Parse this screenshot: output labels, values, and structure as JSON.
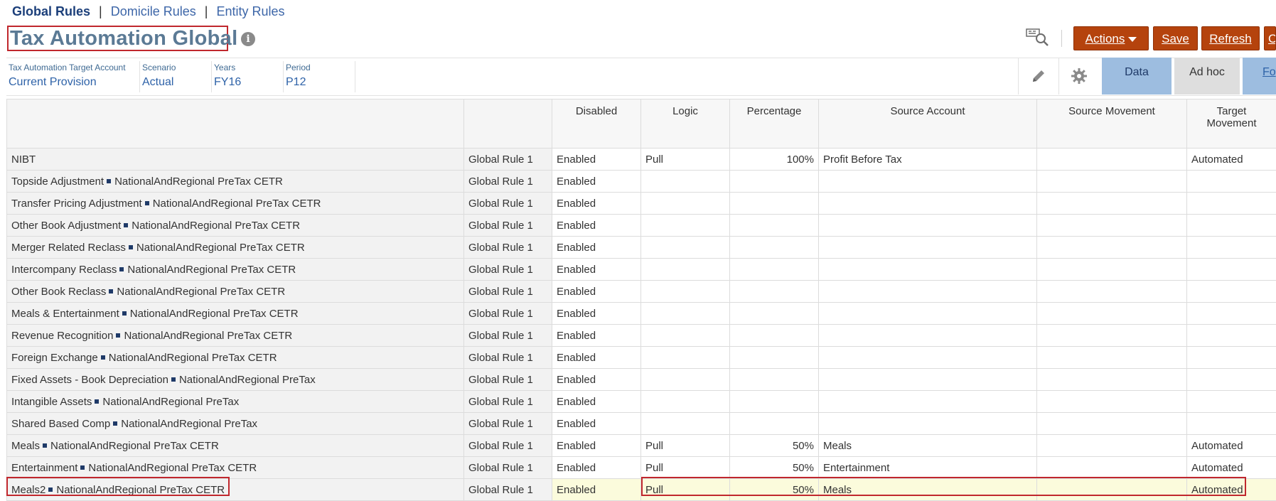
{
  "nav": {
    "tabs": [
      "Global Rules",
      "Domicile Rules",
      "Entity Rules"
    ],
    "separator": "|"
  },
  "header": {
    "title": "Tax Automation Global",
    "info_icon": "info-icon",
    "pov_icon": "member-selector-icon"
  },
  "toolbar": {
    "actions_label": "Actions",
    "save_label": "Save",
    "refresh_label": "Refresh",
    "more_label": "C"
  },
  "pov": [
    {
      "label": "Tax Automation Target Account",
      "value": "Current Provision"
    },
    {
      "label": "Scenario",
      "value": "Actual"
    },
    {
      "label": "Years",
      "value": "FY16"
    },
    {
      "label": "Period",
      "value": "P12"
    }
  ],
  "view_tabs": {
    "edit_icon": "pencil-icon",
    "settings_icon": "gear-icon",
    "data_label": "Data",
    "adhoc_label": "Ad hoc",
    "format_label": "Fo"
  },
  "grid": {
    "columns": [
      "Disabled",
      "Logic",
      "Percentage",
      "Source Account",
      "Source Movement",
      "Target Movement"
    ],
    "rows": [
      {
        "account": "NIBT",
        "tag": "",
        "rule": "Global Rule 1",
        "disabled": "Enabled",
        "logic": "Pull",
        "pct": "100%",
        "src_acct": "Profit Before Tax",
        "src_mvmt": "",
        "tgt_mvmt": "Automated"
      },
      {
        "account": "Topside Adjustment",
        "tag": "NationalAndRegional PreTax CETR",
        "rule": "Global Rule 1",
        "disabled": "Enabled",
        "logic": "",
        "pct": "",
        "src_acct": "",
        "src_mvmt": "",
        "tgt_mvmt": ""
      },
      {
        "account": "Transfer Pricing Adjustment",
        "tag": "NationalAndRegional PreTax CETR",
        "rule": "Global Rule 1",
        "disabled": "Enabled",
        "logic": "",
        "pct": "",
        "src_acct": "",
        "src_mvmt": "",
        "tgt_mvmt": ""
      },
      {
        "account": "Other Book Adjustment",
        "tag": "NationalAndRegional PreTax CETR",
        "rule": "Global Rule 1",
        "disabled": "Enabled",
        "logic": "",
        "pct": "",
        "src_acct": "",
        "src_mvmt": "",
        "tgt_mvmt": ""
      },
      {
        "account": "Merger Related Reclass",
        "tag": "NationalAndRegional PreTax CETR",
        "rule": "Global Rule 1",
        "disabled": "Enabled",
        "logic": "",
        "pct": "",
        "src_acct": "",
        "src_mvmt": "",
        "tgt_mvmt": ""
      },
      {
        "account": "Intercompany Reclass",
        "tag": "NationalAndRegional PreTax CETR",
        "rule": "Global Rule 1",
        "disabled": "Enabled",
        "logic": "",
        "pct": "",
        "src_acct": "",
        "src_mvmt": "",
        "tgt_mvmt": ""
      },
      {
        "account": "Other Book Reclass",
        "tag": "NationalAndRegional PreTax CETR",
        "rule": "Global Rule 1",
        "disabled": "Enabled",
        "logic": "",
        "pct": "",
        "src_acct": "",
        "src_mvmt": "",
        "tgt_mvmt": ""
      },
      {
        "account": "Meals & Entertainment",
        "tag": "NationalAndRegional PreTax CETR",
        "rule": "Global Rule 1",
        "disabled": "Enabled",
        "logic": "",
        "pct": "",
        "src_acct": "",
        "src_mvmt": "",
        "tgt_mvmt": ""
      },
      {
        "account": "Revenue Recognition",
        "tag": "NationalAndRegional PreTax CETR",
        "rule": "Global Rule 1",
        "disabled": "Enabled",
        "logic": "",
        "pct": "",
        "src_acct": "",
        "src_mvmt": "",
        "tgt_mvmt": ""
      },
      {
        "account": "Foreign Exchange",
        "tag": "NationalAndRegional PreTax CETR",
        "rule": "Global Rule 1",
        "disabled": "Enabled",
        "logic": "",
        "pct": "",
        "src_acct": "",
        "src_mvmt": "",
        "tgt_mvmt": ""
      },
      {
        "account": "Fixed Assets - Book Depreciation",
        "tag": "NationalAndRegional PreTax",
        "rule": "Global Rule 1",
        "disabled": "Enabled",
        "logic": "",
        "pct": "",
        "src_acct": "",
        "src_mvmt": "",
        "tgt_mvmt": ""
      },
      {
        "account": "Intangible Assets",
        "tag": "NationalAndRegional PreTax",
        "rule": "Global Rule 1",
        "disabled": "Enabled",
        "logic": "",
        "pct": "",
        "src_acct": "",
        "src_mvmt": "",
        "tgt_mvmt": ""
      },
      {
        "account": "Shared Based Comp",
        "tag": "NationalAndRegional PreTax",
        "rule": "Global Rule 1",
        "disabled": "Enabled",
        "logic": "",
        "pct": "",
        "src_acct": "",
        "src_mvmt": "",
        "tgt_mvmt": ""
      },
      {
        "account": "Meals",
        "tag": "NationalAndRegional PreTax CETR",
        "rule": "Global Rule 1",
        "disabled": "Enabled",
        "logic": "Pull",
        "pct": "50%",
        "src_acct": "Meals",
        "src_mvmt": "",
        "tgt_mvmt": "Automated"
      },
      {
        "account": "Entertainment",
        "tag": "NationalAndRegional PreTax CETR",
        "rule": "Global Rule 1",
        "disabled": "Enabled",
        "logic": "Pull",
        "pct": "50%",
        "src_acct": "Entertainment",
        "src_mvmt": "",
        "tgt_mvmt": "Automated"
      },
      {
        "account": "Meals2",
        "tag": "NationalAndRegional PreTax CETR",
        "rule": "Global Rule 1",
        "disabled": "Enabled",
        "logic": "Pull",
        "pct": "50%",
        "src_acct": "Meals",
        "src_mvmt": "",
        "tgt_mvmt": "Automated"
      }
    ]
  },
  "colors": {
    "accent_button": "#b5430d",
    "title": "#5b7a95",
    "highlight_border": "#c0272d",
    "highlight_row": "#fbfbdc"
  }
}
